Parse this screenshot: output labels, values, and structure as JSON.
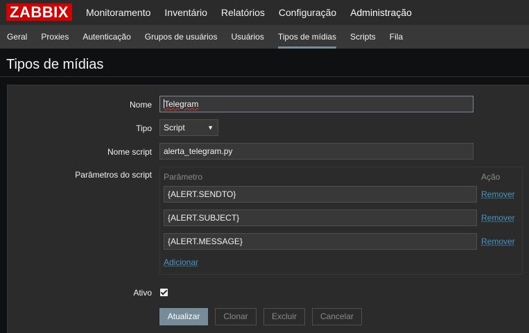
{
  "app": {
    "logo": "ZABBIX"
  },
  "topmenu": [
    {
      "label": "Monitoramento"
    },
    {
      "label": "Inventário"
    },
    {
      "label": "Relatórios"
    },
    {
      "label": "Configuração"
    },
    {
      "label": "Administração",
      "active": true
    }
  ],
  "submenu": [
    {
      "label": "Geral"
    },
    {
      "label": "Proxies"
    },
    {
      "label": "Autenticação"
    },
    {
      "label": "Grupos de usuários"
    },
    {
      "label": "Usuários"
    },
    {
      "label": "Tipos de mídias",
      "active": true
    },
    {
      "label": "Scripts"
    },
    {
      "label": "Fila"
    }
  ],
  "page": {
    "title": "Tipos de mídias"
  },
  "form": {
    "name_label": "Nome",
    "name_value": "Telegram",
    "type_label": "Tipo",
    "type_value": "Script",
    "script_label": "Nome script",
    "script_value": "alerta_telegram.py",
    "params_label": "Parâmetros do script",
    "params_header_param": "Parâmetro",
    "params_header_action": "Ação",
    "params": [
      {
        "value": "{ALERT.SENDTO}",
        "action": "Remover"
      },
      {
        "value": "{ALERT.SUBJECT}",
        "action": "Remover"
      },
      {
        "value": "{ALERT.MESSAGE}",
        "action": "Remover"
      }
    ],
    "add_link": "Adicionar",
    "active_label": "Ativo",
    "active_checked": true
  },
  "buttons": {
    "update": "Atualizar",
    "clone": "Clonar",
    "delete": "Excluir",
    "cancel": "Cancelar"
  },
  "colors": {
    "brand": "#d40000",
    "accent": "#768d99",
    "link": "#4796c4"
  }
}
